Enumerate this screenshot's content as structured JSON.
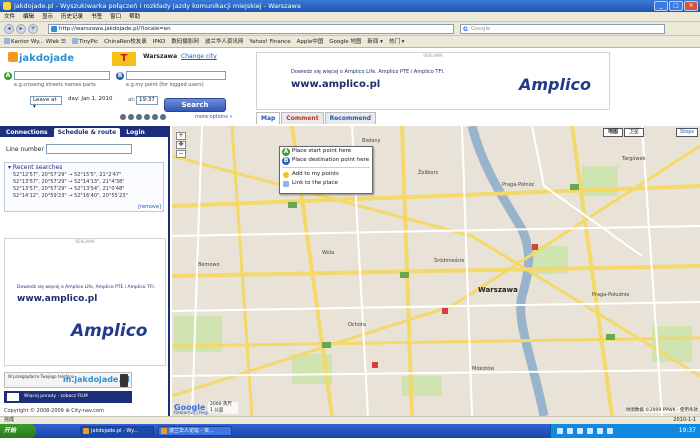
{
  "window": {
    "title": "jakdojade.pl - Wyszukiwarka połączeń i rozkłady jazdy komunikacji miejskiej - Warszawa",
    "controls": [
      "_",
      "□",
      "×"
    ]
  },
  "menu": [
    "文件",
    "编辑",
    "显示",
    "历史记录",
    "书签",
    "窗口",
    "帮助"
  ],
  "nav": {
    "url": "http://warszawa.jakdojade.pl/?locale=en",
    "search_placeholder": "Google"
  },
  "bookmarks": [
    "Kantor Wy... Wlek ☰",
    "TinyPic",
    "ChinaRen校友录",
    "IPKO",
    "数码摄影网",
    "波兰华人资讯网",
    "Yahoo! Finance",
    "Apple中国",
    "Google 地图",
    "新闻 ▾",
    "热门 ▾"
  ],
  "header": {
    "logo": "jakdojade",
    "city": "Warszawa",
    "change_city": "Change city",
    "from_hint": "e.g.crossing streets names parts",
    "to_hint": "e.g.my point (for logged users)",
    "leave_at": "Leave at",
    "day": "day: Jan 1, 2010",
    "at": "at:",
    "time": "19:37",
    "search_button": "Search",
    "more_options": "more options »"
  },
  "ad_top": {
    "reklama": "REKLAMA",
    "text": "Dowiedz się więcej o Amplico Life, Amplico PTE i Amplico TFI.",
    "url": "www.amplico.pl",
    "brand": "Amplico"
  },
  "map_tabs": [
    "Map",
    "Comment",
    "Recommend"
  ],
  "sidebar": {
    "tabs": [
      "Connections",
      "Schedule & route",
      "Login"
    ],
    "line_number_label": "Line number",
    "recent_title": "Recent searches",
    "recent_rows": [
      "52°12'57\", 20°57'29\" → 52°15'5\", 21°2'47\"",
      "52°13'57\", 20°57'29\" → 52°14'13\", 21°4'38\"",
      "52°13'57\", 20°57'29\" → 52°13'54\", 21°0'48\"",
      "52°14'12\", 20°59'23\" → 52°16'40\", 20°55'23\""
    ],
    "remove": "[remove]",
    "ad": {
      "reklama": "REKLAMA",
      "text": "Dowiedz się więcej o Amplico Life, Amplico PTE i Amplico TFI.",
      "url": "www.amplico.pl",
      "brand": "Amplico"
    },
    "mobile_small": "W przeglądarce Twojego telefonu",
    "mobile_brand": "m.jakdojade.pl",
    "video_label": "Więcej porady - zobacz FILM",
    "copyright": "Copyright © 2008-2009 ⊕ City-nav.com"
  },
  "map": {
    "type_buttons": [
      "地图",
      "卫星"
    ],
    "stops": "Stops",
    "context_menu": {
      "start": "Place start point here",
      "destination": "Place destination point here",
      "add": "Add to my points",
      "link": "Link to the place"
    },
    "labels": {
      "city": "Warszawa",
      "l1": "Bemowo",
      "l2": "Wola",
      "l3": "Ochota",
      "l4": "Praga-Północ",
      "l5": "Praga-Południe",
      "l6": "Śródmieście",
      "l7": "Mokotów",
      "l8": "Bielany",
      "l9": "Żoliborz",
      "l10": "Targówek"
    },
    "google": "Google",
    "reklamuj": "Reklamuj | Regulamin",
    "scale_top": "2000 英尺",
    "scale_bottom": "1 公里",
    "copyright": "地图数据 ©2009 PPWK - 使用条款"
  },
  "status": {
    "left": "完成",
    "right": "2010-1-1"
  },
  "taskbar": {
    "start": "开始",
    "tasks": [
      "jakdojade.pl - Wy...",
      "波兰华人论坛 - 资..."
    ],
    "clock": "19:37"
  }
}
